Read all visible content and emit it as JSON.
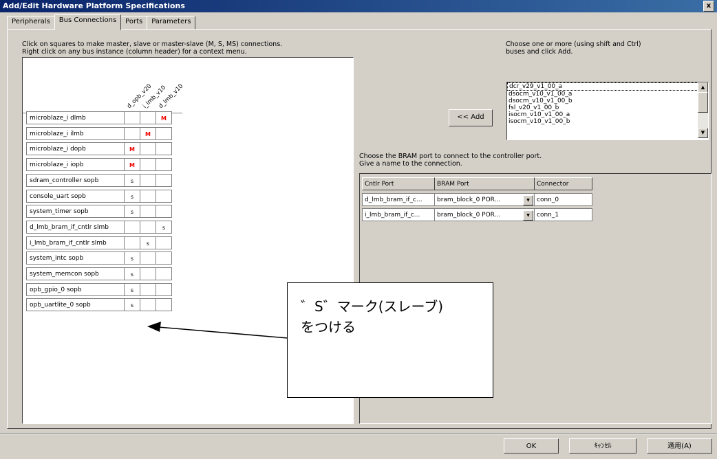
{
  "window": {
    "title": "Add/Edit Hardware Platform Specifications",
    "close_label": "x"
  },
  "tabs": [
    {
      "label": "Peripherals"
    },
    {
      "label": "Bus Connections",
      "active": true
    },
    {
      "label": "Ports"
    },
    {
      "label": "Parameters"
    }
  ],
  "instructions": {
    "line1": "Click on squares to make master, slave or master-slave (M, S, MS) connections.",
    "line2": "Right click on any bus instance (column header) for a context menu."
  },
  "choose": {
    "line1": "Choose one or more (using shift and Ctrl)",
    "line2": "buses and click Add."
  },
  "matrix": {
    "columns": [
      "d_opb_v20",
      "i_lmb_v10",
      "d_lmb_v10"
    ],
    "rows": [
      {
        "label": "microblaze_i dlmb",
        "cells": [
          "",
          "",
          "M"
        ]
      },
      {
        "label": "microblaze_i ilmb",
        "cells": [
          "",
          "M",
          ""
        ]
      },
      {
        "label": "microblaze_i dopb",
        "cells": [
          "M",
          "",
          ""
        ]
      },
      {
        "label": "microblaze_i iopb",
        "cells": [
          "M",
          "",
          ""
        ]
      },
      {
        "label": "sdram_controller sopb",
        "cells": [
          "s",
          "",
          ""
        ]
      },
      {
        "label": "console_uart sopb",
        "cells": [
          "s",
          "",
          ""
        ]
      },
      {
        "label": "system_timer sopb",
        "cells": [
          "s",
          "",
          ""
        ]
      },
      {
        "label": "d_lmb_bram_if_cntlr slmb",
        "cells": [
          "",
          "",
          "s"
        ]
      },
      {
        "label": "i_lmb_bram_if_cntlr slmb",
        "cells": [
          "",
          "s",
          ""
        ]
      },
      {
        "label": "system_intc sopb",
        "cells": [
          "s",
          "",
          ""
        ]
      },
      {
        "label": "system_memcon sopb",
        "cells": [
          "s",
          "",
          ""
        ]
      },
      {
        "label": "opb_gpio_0 sopb",
        "cells": [
          "s",
          "",
          ""
        ]
      },
      {
        "label": "opb_uartlite_0 sopb",
        "cells": [
          "s",
          "",
          ""
        ]
      }
    ]
  },
  "bus_list": {
    "items": [
      "dcr_v29_v1_00_a",
      "dsocm_v10_v1_00_a",
      "dsocm_v10_v1_00_b",
      "fsl_v20_v1_00_b",
      "isocm_v10_v1_00_a",
      "isocm_v10_v1_00_b"
    ],
    "selected_index": 0
  },
  "add_button": "<< Add",
  "bram": {
    "instruction1": "Choose the BRAM port to connect to the controller port.",
    "instruction2": "Give a name to the connection.",
    "headers": [
      "Cntlr Port",
      "BRAM Port",
      "Connector"
    ],
    "rows": [
      {
        "cntlr": "d_lmb_bram_if_c...",
        "bram": "bram_block_0 POR...",
        "connector": "conn_0"
      },
      {
        "cntlr": "i_lmb_bram_if_c...",
        "bram": "bram_block_0 POR...",
        "connector": "conn_1"
      }
    ]
  },
  "callout": {
    "line1": "゛S゛マーク(スレーブ)",
    "line2": "をつける"
  },
  "buttons": {
    "ok": "OK",
    "cancel": "ｷｬﾝｾﾙ",
    "apply": "適用(A)"
  }
}
